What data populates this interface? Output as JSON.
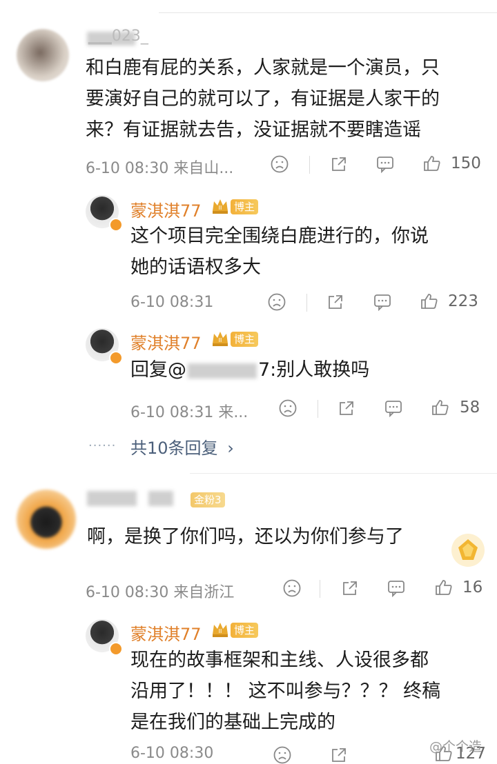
{
  "comments": [
    {
      "user": "▁▁023_",
      "text_lines": [
        "和白鹿有屁的关系，人家就是一个演员，只",
        "要演好自己的就可以了，有证据是人家干的",
        "来？有证据就去告，没证据就不要瞎造谣"
      ],
      "meta": "6-10 08:30 来自山...",
      "likes": "150",
      "replies": [
        {
          "user": "蒙淇淇77",
          "badge": "博主",
          "text_lines": [
            "这个项目完全围绕白鹿进行的，你说",
            "她的话语权多大"
          ],
          "meta": "6-10 08:31",
          "likes": "223"
        },
        {
          "user": "蒙淇淇77",
          "badge": "博主",
          "reply_prefix": "回复@",
          "reply_suffix": "7:别人敢换吗",
          "meta": "6-10 08:31 来...",
          "likes": "58"
        }
      ],
      "more_replies": "共10条回复"
    },
    {
      "user_badge": "金粉3",
      "text": "啊，是换了你们吗，还以为你们参与了",
      "meta": "6-10 08:30 来自浙江",
      "likes": "16",
      "replies": [
        {
          "user": "蒙淇淇77",
          "badge": "博主",
          "text_lines": [
            "现在的故事框架和主线、人设很多都",
            "沿用了！！！ 这不叫参与？？？ 终稿",
            "是在我们的基础上完成的"
          ],
          "meta": "6-10 08:30",
          "likes": "127"
        }
      ]
    }
  ],
  "watermark": "@个个造"
}
